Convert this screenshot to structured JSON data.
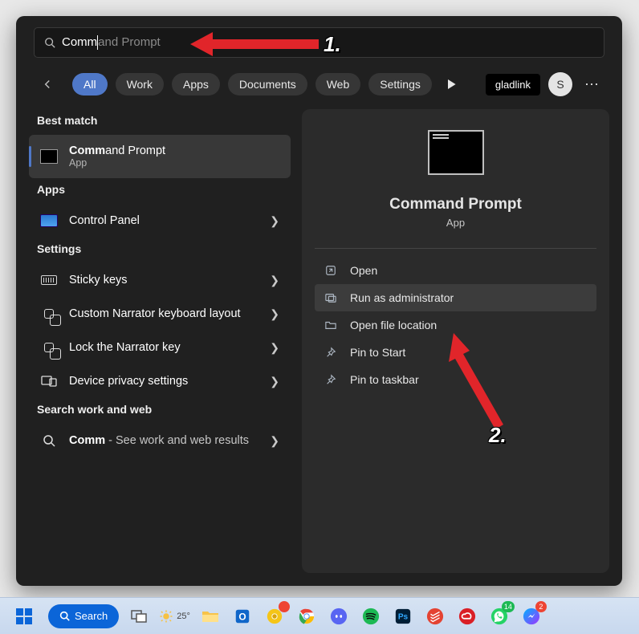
{
  "search": {
    "typed": "Comm",
    "suggestion_rest": "and Prompt"
  },
  "tabs": {
    "items": [
      "All",
      "Work",
      "Apps",
      "Documents",
      "Web",
      "Settings"
    ],
    "extension": "gladlink",
    "avatar_initial": "S"
  },
  "annotations": {
    "step1": "1.",
    "step2": "2."
  },
  "left": {
    "best_match_header": "Best match",
    "best_match": {
      "title_bold": "Comm",
      "title_rest": "and Prompt",
      "subtitle": "App"
    },
    "apps_header": "Apps",
    "apps": [
      {
        "title": "Control Panel"
      }
    ],
    "settings_header": "Settings",
    "settings": [
      {
        "title": "Sticky keys"
      },
      {
        "title": "Custom Narrator keyboard layout"
      },
      {
        "title": "Lock the Narrator key"
      },
      {
        "title": "Device privacy settings"
      }
    ],
    "web_header": "Search work and web",
    "web": [
      {
        "title_bold": "Comm",
        "title_rest": " - See work and web results"
      }
    ]
  },
  "detail": {
    "title": "Command Prompt",
    "subtitle": "App",
    "actions": [
      "Open",
      "Run as administrator",
      "Open file location",
      "Pin to Start",
      "Pin to taskbar"
    ]
  },
  "taskbar": {
    "search_label": "Search",
    "weather": "25°",
    "whatsapp_badge": "14",
    "messenger_badge": "2"
  }
}
